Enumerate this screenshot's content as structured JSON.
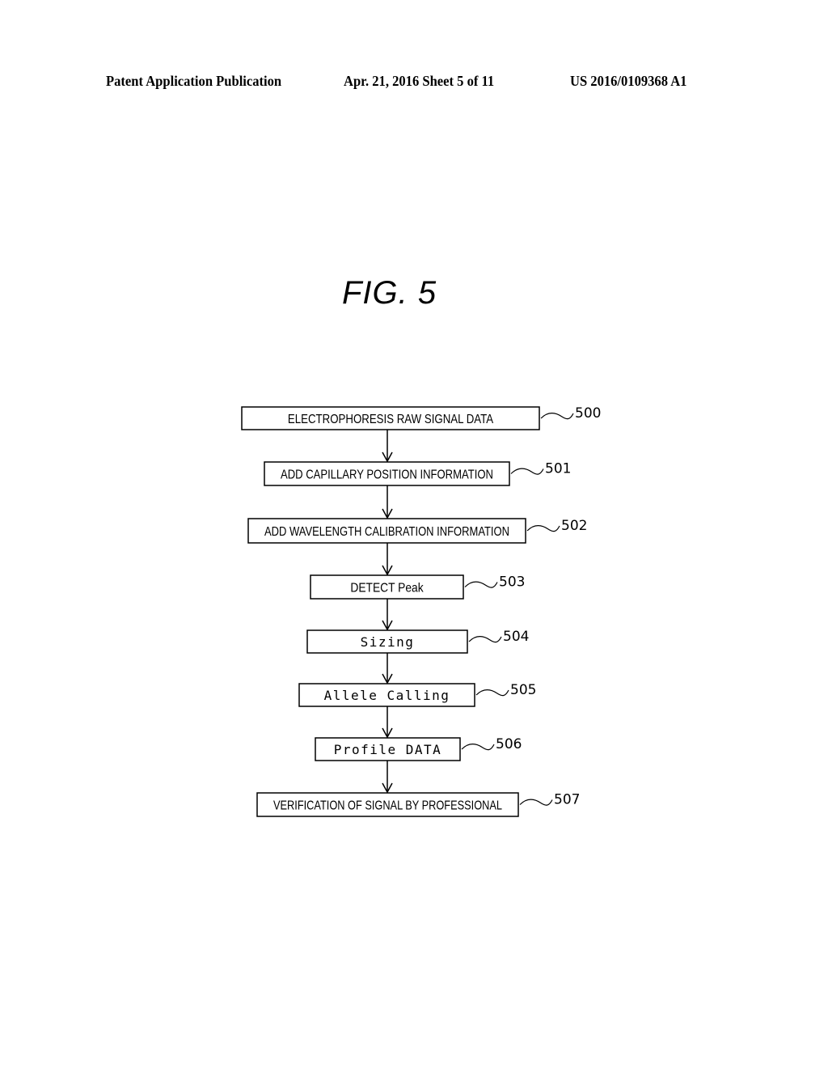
{
  "header": {
    "publication": "Patent Application Publication",
    "date_sheet": "Apr. 21, 2016  Sheet 5 of 11",
    "number": "US 2016/0109368 A1"
  },
  "figure": {
    "title": "FIG. 5"
  },
  "flowchart": {
    "steps": [
      {
        "label": "ELECTROPHORESIS RAW SIGNAL DATA",
        "ref": "500"
      },
      {
        "label": "ADD CAPILLARY POSITION INFORMATION",
        "ref": "501"
      },
      {
        "label": "ADD WAVELENGTH CALIBRATION INFORMATION",
        "ref": "502"
      },
      {
        "label": "DETECT Peak",
        "ref": "503"
      },
      {
        "label": "Sizing",
        "ref": "504"
      },
      {
        "label": "Allele Calling",
        "ref": "505"
      },
      {
        "label": "Profile DATA",
        "ref": "506"
      },
      {
        "label": "VERIFICATION OF SIGNAL BY PROFESSIONAL",
        "ref": "507"
      }
    ]
  }
}
